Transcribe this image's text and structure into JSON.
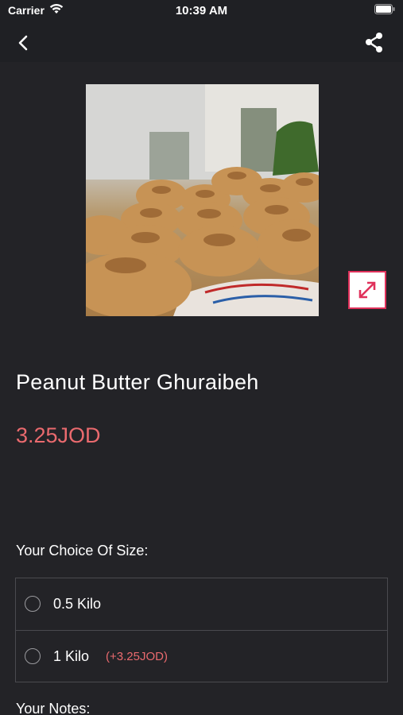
{
  "status_bar": {
    "carrier": "Carrier",
    "time": "10:39 AM"
  },
  "nav": {
    "back_icon": "chevron-left-icon",
    "share_icon": "share-icon"
  },
  "product": {
    "image_description_icon": "product-photo",
    "title": "Peanut Butter Ghuraibeh",
    "price": "3.25JOD",
    "expand_icon": "expand-icon"
  },
  "size_choice": {
    "heading": "Your Choice Of Size:",
    "options": [
      {
        "label": "0.5 Kilo",
        "extra": ""
      },
      {
        "label": "1 Kilo",
        "extra": "(+3.25JOD)"
      }
    ]
  },
  "notes": {
    "heading": "Your Notes:"
  },
  "colors": {
    "background": "#232327",
    "bar": "#1f2024",
    "accent": "#ea6a6e",
    "expand_border": "#e0315b"
  }
}
